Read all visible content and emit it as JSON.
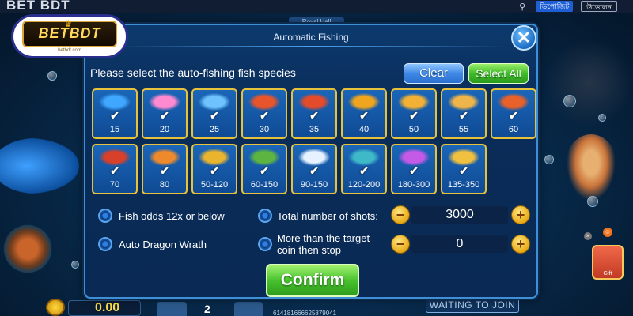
{
  "site": {
    "title": "BET BDT",
    "deposit_label": "ডিপোজিট",
    "withdraw_label": "উত্তোলন",
    "logo_text": "BETBDT",
    "logo_subtext": "betbdt.com"
  },
  "game": {
    "room_label": "Royal Hall",
    "coins": "0.00",
    "bet": "2",
    "player_id": "614181666625879041",
    "waiting_label": "WAITING TO JOIN",
    "gift_label": "Gift"
  },
  "dialog": {
    "title": "Automatic Fishing",
    "instruction": "Please select the auto-fishing fish species",
    "clear_label": "Clear",
    "select_all_label": "Select All",
    "confirm_label": "Confirm",
    "close_label": "✕"
  },
  "fish_row1": [
    {
      "odds": "15",
      "icon": "blue-fish-icon",
      "color": "#3fa7ff",
      "checked": true
    },
    {
      "odds": "20",
      "icon": "striped-fish-icon",
      "color": "#ff8ad0",
      "checked": true
    },
    {
      "odds": "25",
      "icon": "needle-fish-icon",
      "color": "#6ec3ff",
      "checked": true
    },
    {
      "odds": "30",
      "icon": "crab-eggs-icon",
      "color": "#e8552b",
      "checked": true
    },
    {
      "odds": "35",
      "icon": "red-coral-icon",
      "color": "#e34b2a",
      "checked": true
    },
    {
      "odds": "40",
      "icon": "golden-squid-icon",
      "color": "#f0a51e",
      "checked": true
    },
    {
      "odds": "50",
      "icon": "gold-fish-icon",
      "color": "#f2b134",
      "checked": true
    },
    {
      "odds": "55",
      "icon": "manta-ray-icon",
      "color": "#f0b54a",
      "checked": true
    },
    {
      "odds": "60",
      "icon": "red-fish-icon",
      "color": "#e8602a",
      "checked": true
    }
  ],
  "fish_row2": [
    {
      "odds": "70",
      "icon": "red-crab-icon",
      "color": "#d8402a",
      "checked": true
    },
    {
      "odds": "80",
      "icon": "lobster-icon",
      "color": "#ef8a2c",
      "checked": true
    },
    {
      "odds": "50-120",
      "icon": "golden-turtle-icon",
      "color": "#e9b52f",
      "checked": true
    },
    {
      "odds": "60-150",
      "icon": "crocodile-icon",
      "color": "#5eb441",
      "checked": true
    },
    {
      "odds": "90-150",
      "icon": "white-whale-icon",
      "color": "#e6f2ff",
      "checked": true
    },
    {
      "odds": "120-200",
      "icon": "sea-dragon-icon",
      "color": "#3fb9c8",
      "checked": true
    },
    {
      "odds": "180-300",
      "icon": "phoenix-fish-icon",
      "color": "#c45ae6",
      "checked": true
    },
    {
      "odds": "135-350",
      "icon": "golden-dragon-icon",
      "color": "#f0c040",
      "checked": true
    }
  ],
  "options": {
    "fish_odds_label": "Fish odds 12x or below",
    "auto_dragon_label": "Auto Dragon Wrath",
    "total_shots_label": "Total number of shots:",
    "total_shots_value": "3000",
    "target_coin_label": "More than the target coin then stop",
    "target_coin_value": "0",
    "minus_label": "−",
    "plus_label": "+"
  }
}
